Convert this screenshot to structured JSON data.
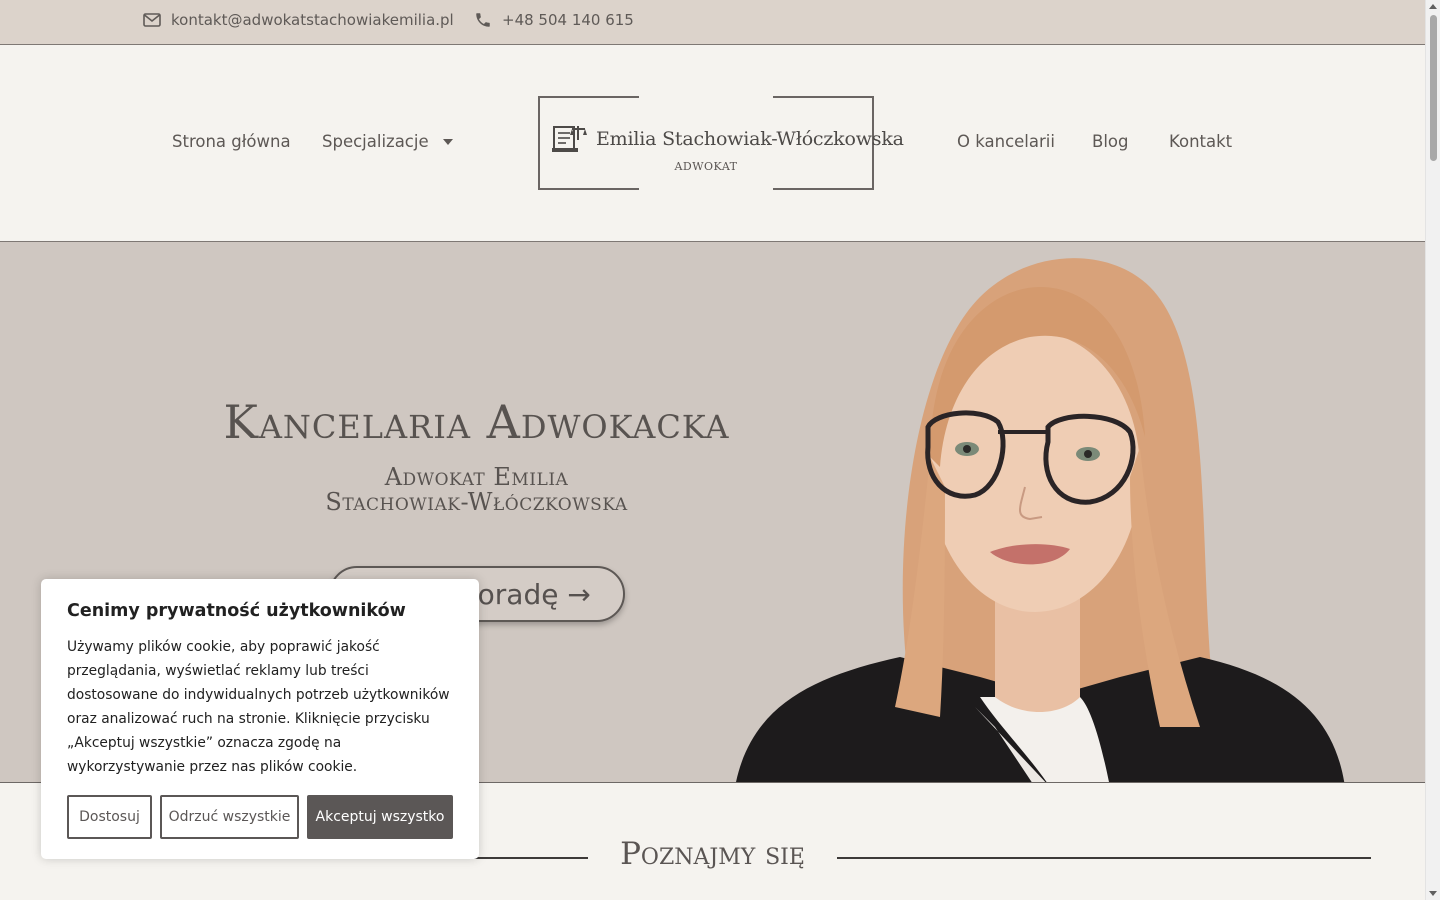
{
  "topbar": {
    "email": "kontakt@adwokatstachowiakemilia.pl",
    "phone": "+48 504 140 615"
  },
  "nav": {
    "home": "Strona główna",
    "specializations": "Specjalizacje",
    "about": "O kancelarii",
    "blog": "Blog",
    "contact": "Kontakt"
  },
  "logo": {
    "title": "Emilia Stachowiak-Włóczkowska",
    "subtitle": "ADWOKAT"
  },
  "hero": {
    "title": "Kancelaria Adwokacka",
    "subtitle_line1": "Adwokat Emilia",
    "subtitle_line2": "Stachowiak-Włóczkowska",
    "cta": "Umów poradę →"
  },
  "section": {
    "title": "Poznajmy się"
  },
  "cookie": {
    "title": "Cenimy prywatność użytkowników",
    "text": "Używamy plików cookie, aby poprawić jakość przeglądania, wyświetlać reklamy lub treści dostosowane do indywidualnych potrzeb użytkowników oraz analizować ruch na stronie. Kliknięcie przycisku „Akceptuj wszystkie” oznacza zgodę na wykorzystywanie przez nas plików cookie.",
    "customize": "Dostosuj",
    "reject": "Odrzuć wszystkie",
    "accept": "Akceptuj wszystko"
  },
  "colors": {
    "topbar_bg": "#dcd3cb",
    "hero_bg": "#cfc7c1",
    "page_bg": "#f5f3ef",
    "accent_dark": "#5b5756"
  }
}
